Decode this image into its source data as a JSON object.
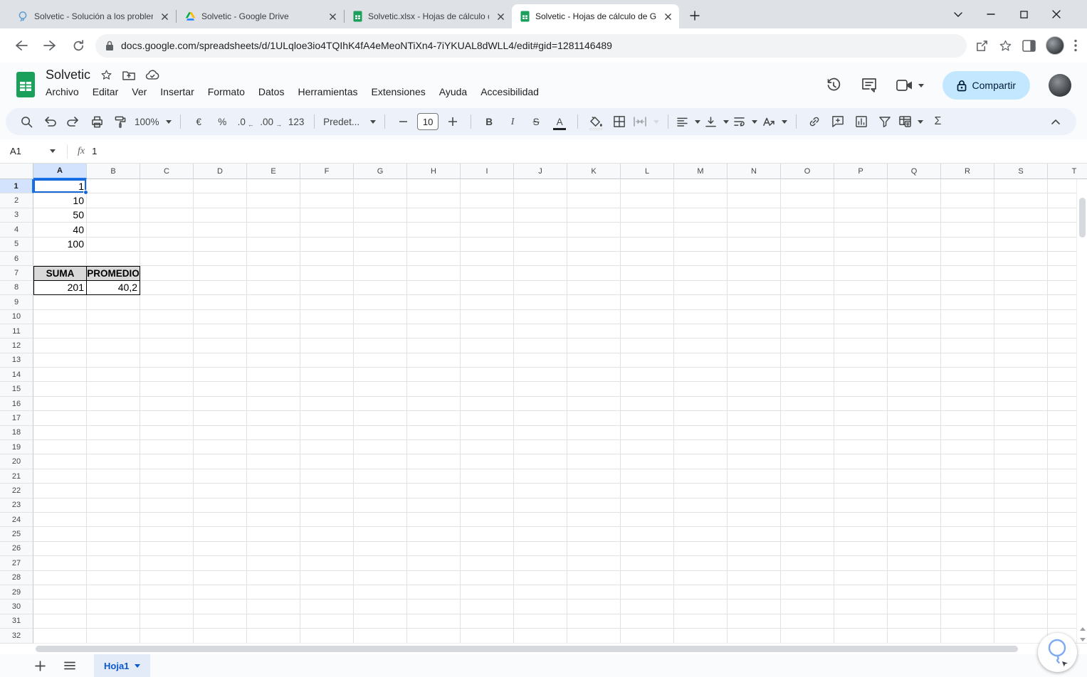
{
  "browser": {
    "tabs": [
      {
        "title": "Solvetic - Solución a los problem",
        "favicon": "solvetic-bulb-icon",
        "active": false
      },
      {
        "title": "Solvetic - Google Drive",
        "favicon": "google-drive-icon",
        "active": false
      },
      {
        "title": "Solvetic.xlsx - Hojas de cálculo d",
        "favicon": "google-sheets-icon",
        "active": false
      },
      {
        "title": "Solvetic - Hojas de cálculo de Go",
        "favicon": "google-sheets-icon",
        "active": true
      }
    ],
    "url": "docs.google.com/spreadsheets/d/1ULqloe3io4TQIhK4fA4eMeoNTiXn4-7iYKUAL8dWLL4/edit#gid=1281146489"
  },
  "header": {
    "doc_title": "Solvetic",
    "menu_items": [
      "Archivo",
      "Editar",
      "Ver",
      "Insertar",
      "Formato",
      "Datos",
      "Herramientas",
      "Extensiones",
      "Ayuda",
      "Accesibilidad"
    ],
    "share_button": "Compartir"
  },
  "toolbar": {
    "zoom_value": "100%",
    "currency_label": "€",
    "percent_label": "%",
    "decrease_decimals_label": ".0",
    "increase_decimals_label": ".00",
    "more_formats_label": "123",
    "font_name": "Predet...",
    "font_size": "10",
    "bold_label": "B",
    "italic_label": "I",
    "strikethrough_label": "S",
    "text_color_label": "A",
    "functions_label": "Σ"
  },
  "formula_bar": {
    "cell_reference": "A1",
    "fx_label": "fx",
    "formula_value": "1"
  },
  "grid": {
    "column_headers": [
      "A",
      "B",
      "C",
      "D",
      "E",
      "F",
      "G",
      "H",
      "I",
      "J",
      "K",
      "L",
      "M",
      "N",
      "O",
      "P",
      "Q",
      "R",
      "S",
      "T"
    ],
    "row_count": 32,
    "selected_cell": "A1",
    "cells": {
      "A1": {
        "value": "1",
        "type": "number"
      },
      "A2": {
        "value": "10",
        "type": "number"
      },
      "A3": {
        "value": "50",
        "type": "number"
      },
      "A4": {
        "value": "40",
        "type": "number"
      },
      "A5": {
        "value": "100",
        "type": "number"
      },
      "A7": {
        "value": "SUMA",
        "type": "table-header",
        "edges": [
          "left",
          "top"
        ]
      },
      "B7": {
        "value": "PROMEDIO",
        "type": "table-header",
        "edges": [
          "top"
        ]
      },
      "A8": {
        "value": "201",
        "type": "table-value",
        "edges": [
          "left"
        ]
      },
      "B8": {
        "value": "40,2",
        "type": "table-value"
      }
    }
  },
  "sheet_bar": {
    "active_sheet": "Hoja1"
  },
  "icons": {
    "solvetic-bulb-icon": "blue lightbulb outline",
    "google-drive-icon": "tricolor triangle",
    "google-sheets-icon": "green sheet with white grid",
    "lock-icon": "padlock",
    "explore-icon": "sketched lightbulb"
  },
  "colors": {
    "accent_blue": "#1a73e8",
    "share_button_bg": "#c2e7ff",
    "selected_header_bg": "#d3e3fd",
    "table_header_bg": "#d9d9d9",
    "sheets_green": "#1ba05b",
    "toolbar_bg": "#edf2fa"
  }
}
